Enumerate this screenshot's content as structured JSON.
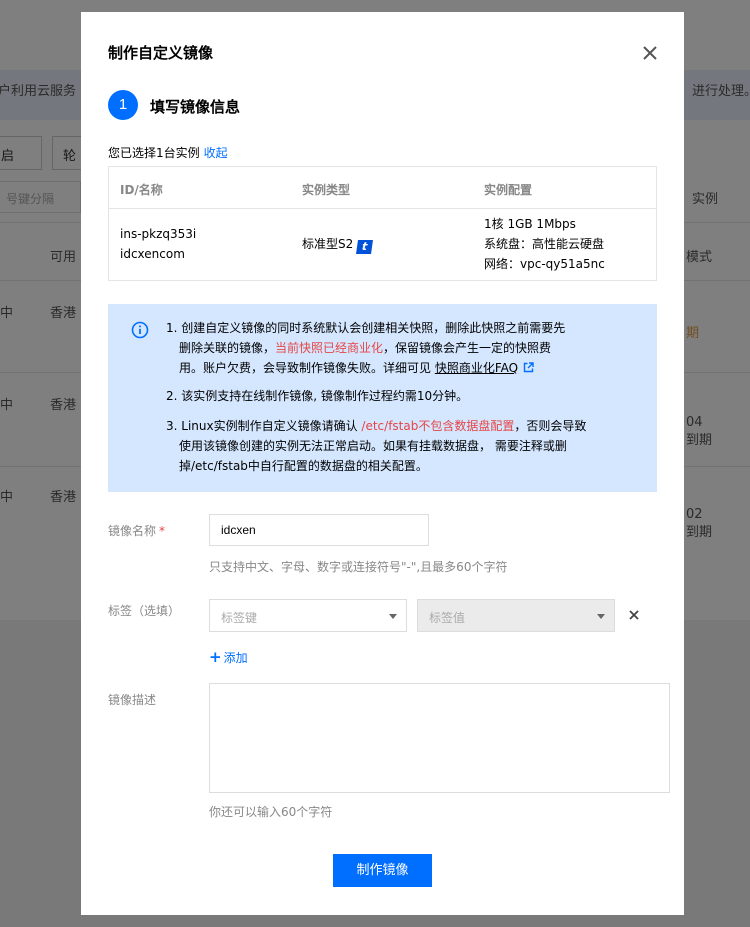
{
  "background": {
    "banner_left": "户利用云服务",
    "banner_right": "进行处理。",
    "button_1": "启",
    "button_2": "轮",
    "search_placeholder": "号键分隔",
    "right_header": "实例",
    "col_available": "可用",
    "col_mode": "模式",
    "rows": [
      {
        "status": "中",
        "region": "香港",
        "extra": "期"
      },
      {
        "status": "中",
        "region": "香港",
        "extra": "04\n到期"
      },
      {
        "status": "中",
        "region": "香港",
        "extra": "02\n到期"
      }
    ]
  },
  "modal": {
    "title": "制作自定义镜像",
    "step_number": "1",
    "step_title": "填写镜像信息",
    "selected_prefix": "您已选择1台实例",
    "collapse_link": "收起",
    "table": {
      "headers": [
        "ID/名称",
        "实例类型",
        "实例配置"
      ],
      "row": {
        "id": "ins-pkzq353i",
        "name": "idcxencom",
        "type": "标准型S2",
        "type_badge": "t",
        "config_line1": "1核 1GB 1Mbps",
        "config_line2": "系统盘：高性能云硬盘",
        "config_line3": "网络：vpc-qy51a5nc"
      }
    },
    "notice": {
      "item1_a": "1. 创建自定义镜像的同时系统默认会创建相关快照，删除此快照之前需要先",
      "item1_b": "删除关联的镜像，",
      "item1_red": "当前快照已经商业化",
      "item1_c": "，保留镜像会产生一定的快照费",
      "item1_d": "用。账户欠费，会导致制作镜像失败。详细可见 ",
      "item1_link": "快照商业化FAQ",
      "item2": "2. 该实例支持在线制作镜像, 镜像制作过程约需10分钟。",
      "item3_a": "3. Linux实例制作自定义镜像请确认 ",
      "item3_red": "/etc/fstab不包含数据盘配置",
      "item3_b": "，否则会导致",
      "item3_c": "使用该镜像创建的实例无法正常启动。如果有挂载数据盘， 需要注释或删",
      "item3_d": "掉/etc/fstab中自行配置的数据盘的相关配置。"
    },
    "form": {
      "name_label": "镜像名称",
      "name_required": "*",
      "name_value": "idcxen",
      "name_hint": "只支持中文、字母、数字或连接符号\"-\",且最多60个字符",
      "tag_label": "标签（选填）",
      "tag_key_placeholder": "标签键",
      "tag_value_placeholder": "标签值",
      "add_label": "添加",
      "add_plus": "+",
      "desc_label": "镜像描述",
      "desc_value": "",
      "desc_hint": "你还可以输入60个字符"
    },
    "submit_label": "制作镜像"
  },
  "colors": {
    "primary": "#006eff",
    "warning_red": "#e54545",
    "notice_bg": "#d5e7ff"
  }
}
